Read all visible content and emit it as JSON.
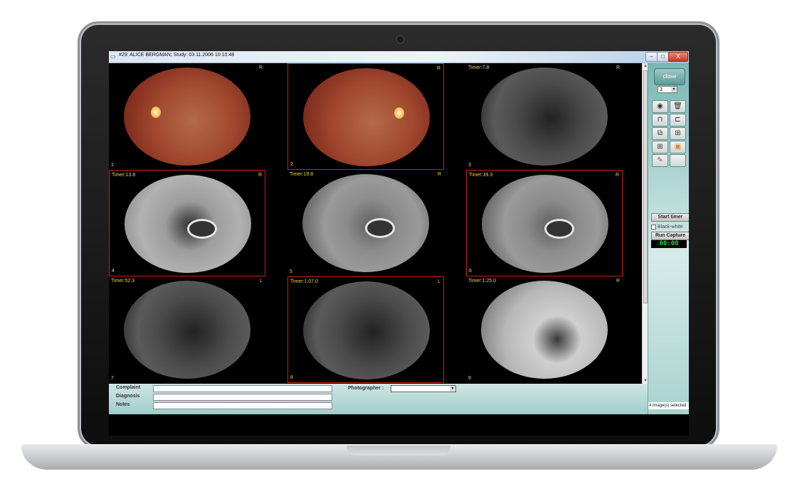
{
  "window": {
    "title": "#29: ALICE BERGMAN; Study: 03.11.2006 10:10:48",
    "min_label": "–",
    "max_label": "□",
    "close_label": "X"
  },
  "images": [
    {
      "number": "1",
      "timer": "",
      "eye": "R",
      "type": "color",
      "selected": false
    },
    {
      "number": "2",
      "timer": "",
      "eye": "R",
      "type": "color",
      "selected": true
    },
    {
      "number": "3",
      "timer": "Timer:7.8",
      "eye": "R",
      "type": "fa",
      "selected": false
    },
    {
      "number": "4",
      "timer": "Timer:13.8",
      "eye": "R",
      "type": "fa",
      "selected": true
    },
    {
      "number": "5",
      "timer": "Timer:19.8",
      "eye": "R",
      "type": "fa",
      "selected": false
    },
    {
      "number": "6",
      "timer": "Timer:39.3",
      "eye": "R",
      "type": "fa",
      "selected": true
    },
    {
      "number": "7",
      "timer": "Timer:52.3",
      "eye": "L",
      "type": "fa",
      "selected": false
    },
    {
      "number": "8",
      "timer": "Timer:1:07.0",
      "eye": "L",
      "type": "fa",
      "selected": true
    },
    {
      "number": "9",
      "timer": "Timer:1:25.0",
      "eye": "R",
      "type": "fa",
      "selected": false
    }
  ],
  "panel": {
    "close_label": "close",
    "columns_value": "3",
    "start_timer_label": "Start timer",
    "black_white_label": "Black-white",
    "run_capture_label": "Run Capture",
    "timer_display": "00:00",
    "selection_status": "4 image(s) selected",
    "tool_icons": [
      "camera-icon",
      "trash-icon",
      "tool-a-icon",
      "tool-b-icon",
      "tool-c-icon",
      "tool-d-icon",
      "tool-e-icon",
      "compare-icon",
      "edit-icon",
      "blank-icon"
    ]
  },
  "form": {
    "complaint_label": "Complaint",
    "diagnosis_label": "Diagnosis",
    "notes_label": "Notes",
    "complaint_value": "",
    "diagnosis_value": "",
    "notes_value": "",
    "photographer_label": "Photographer :",
    "photographer_value": ""
  }
}
